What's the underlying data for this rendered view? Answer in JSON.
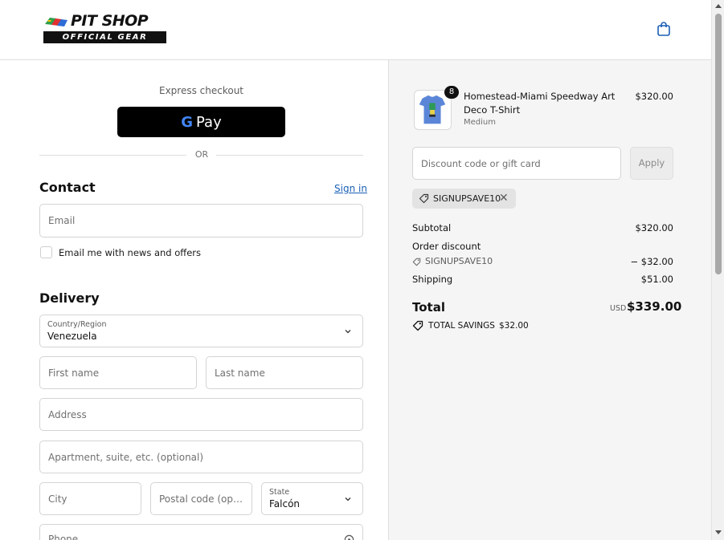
{
  "brand": {
    "name": "PIT SHOP",
    "tagline": "OFFICIAL GEAR"
  },
  "header": {
    "cart_icon": "shopping-bag-icon"
  },
  "express": {
    "label": "Express checkout",
    "gpay_g": "G",
    "gpay_text": "Pay",
    "divider": "OR"
  },
  "contact": {
    "title": "Contact",
    "sign_in": "Sign in",
    "email_placeholder": "Email",
    "news_label": "Email me with news and offers"
  },
  "delivery": {
    "title": "Delivery",
    "country_label": "Country/Region",
    "country_value": "Venezuela",
    "first_name": "First name",
    "last_name": "Last name",
    "address": "Address",
    "apartment": "Apartment, suite, etc. (optional)",
    "city": "City",
    "postal": "Postal code (optional)",
    "state_label": "State",
    "state_value": "Falcón",
    "phone": "Phone"
  },
  "summary": {
    "product": {
      "quantity": "8",
      "name": "Homestead-Miami Speedway Art Deco T-Shirt",
      "variant": "Medium",
      "price": "$320.00"
    },
    "discount_placeholder": "Discount code or gift card",
    "apply_label": "Apply",
    "applied_code": "SIGNUPSAVE10",
    "subtotal_label": "Subtotal",
    "subtotal_value": "$320.00",
    "order_discount_label": "Order discount",
    "discount_code": "SIGNUPSAVE10",
    "discount_value": "− $32.00",
    "shipping_label": "Shipping",
    "shipping_value": "$51.00",
    "total_label": "Total",
    "currency": "USD",
    "total_value": "$339.00",
    "savings_label": "TOTAL SAVINGS",
    "savings_value": "$32.00"
  }
}
